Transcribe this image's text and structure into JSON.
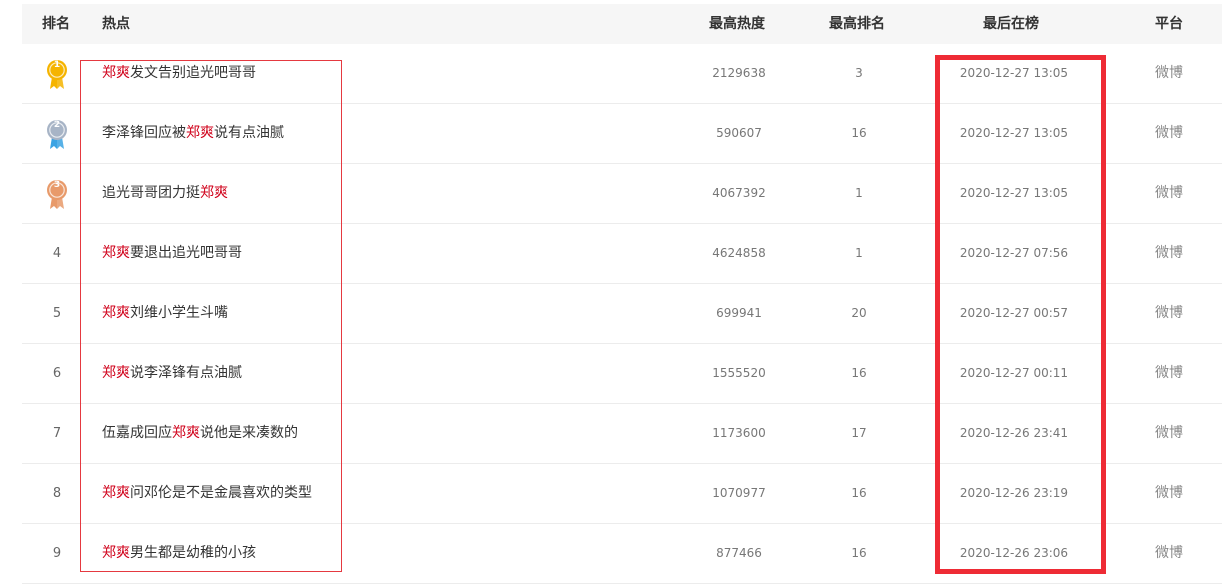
{
  "header": {
    "rank": "排名",
    "topic": "热点",
    "max_heat": "最高热度",
    "max_rank": "最高排名",
    "last_on_list": "最后在榜",
    "platform": "平台"
  },
  "colors": {
    "highlight": "#d0021b",
    "annotation_box": "#ee2b35",
    "gold_medal": "#f5b400",
    "silver_medal": "#a7b4c6",
    "bronze_medal": "#e89a6a"
  },
  "rows": [
    {
      "rank": "1",
      "medal": "gold-medal-icon",
      "pre": "",
      "kw": "郑爽",
      "post": "发文告别追光吧哥哥",
      "heat": "2129638",
      "max_rank": "3",
      "time": "2020-12-27  13:05",
      "platform": "微博"
    },
    {
      "rank": "2",
      "medal": "silver-medal-icon",
      "pre": "李泽锋回应被",
      "kw": "郑爽",
      "post": "说有点油腻",
      "heat": "590607",
      "max_rank": "16",
      "time": "2020-12-27  13:05",
      "platform": "微博"
    },
    {
      "rank": "3",
      "medal": "bronze-medal-icon",
      "pre": "追光哥哥团力挺",
      "kw": "郑爽",
      "post": "",
      "heat": "4067392",
      "max_rank": "1",
      "time": "2020-12-27  13:05",
      "platform": "微博"
    },
    {
      "rank": "4",
      "medal": "",
      "pre": "",
      "kw": "郑爽",
      "post": "要退出追光吧哥哥",
      "heat": "4624858",
      "max_rank": "1",
      "time": "2020-12-27  07:56",
      "platform": "微博"
    },
    {
      "rank": "5",
      "medal": "",
      "pre": "",
      "kw": "郑爽",
      "post": "刘维小学生斗嘴",
      "heat": "699941",
      "max_rank": "20",
      "time": "2020-12-27  00:57",
      "platform": "微博"
    },
    {
      "rank": "6",
      "medal": "",
      "pre": "",
      "kw": "郑爽",
      "post": "说李泽锋有点油腻",
      "heat": "1555520",
      "max_rank": "16",
      "time": "2020-12-27  00:11",
      "platform": "微博"
    },
    {
      "rank": "7",
      "medal": "",
      "pre": "伍嘉成回应",
      "kw": "郑爽",
      "post": "说他是来凑数的",
      "heat": "1173600",
      "max_rank": "17",
      "time": "2020-12-26  23:41",
      "platform": "微博"
    },
    {
      "rank": "8",
      "medal": "",
      "pre": "",
      "kw": "郑爽",
      "post": "问邓伦是不是金晨喜欢的类型",
      "heat": "1070977",
      "max_rank": "16",
      "time": "2020-12-26  23:19",
      "platform": "微博"
    },
    {
      "rank": "9",
      "medal": "",
      "pre": "",
      "kw": "郑爽",
      "post": "男生都是幼稚的小孩",
      "heat": "877466",
      "max_rank": "16",
      "time": "2020-12-26  23:06",
      "platform": "微博"
    }
  ]
}
